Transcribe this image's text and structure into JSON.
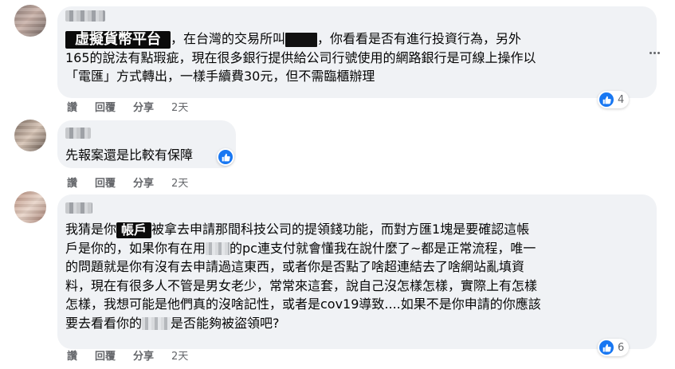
{
  "comments": [
    {
      "label_badge": "虛擬貨幣平台",
      "text_line1_a": "，在台灣的交易所叫",
      "text_line1_b": "，你看看是否有進行投資行為，另外",
      "text_line2": "165的說法有點瑕疵，現在很多銀行提供給公司行號使用的網路銀行是可線上操作以",
      "text_line3": "「電匯」方式轉出，一樣手續費30元，但不需臨櫃辦理",
      "actions": {
        "like": "讚",
        "reply": "回覆",
        "share": "分享",
        "time": "2天"
      },
      "reaction_count": "4"
    },
    {
      "text_line1": "先報案還是比較有保障",
      "actions": {
        "like": "讚",
        "reply": "回覆",
        "share": "分享",
        "time": "2天"
      }
    },
    {
      "line1_a": "我猜是你",
      "line1_badge": "帳戶",
      "line1_b": "被拿去申請那間科技公司的提領錢功能，而對方匯1塊是要確認這帳",
      "line2_a": "戶是你的，如果你有在用",
      "line2_b": "的pc連支付就會懂我在說什麼了~都是正常流程，唯一",
      "line3": "的問題就是你有沒有去申請過這東西，或者你是否點了啥超連結去了啥網站亂填資",
      "line4": "料，現在有很多人不管是男女老少，常常來這套，說自己沒怎樣怎樣，實際上有怎樣",
      "line5": "怎樣，我想可能是他們真的沒啥記性，或者是cov19導致....如果不是你申請的你應該",
      "line6_a": "要去看看你的",
      "line6_b": "是否能夠被盜領吧?",
      "actions": {
        "like": "讚",
        "reply": "回覆",
        "share": "分享",
        "time": "2天"
      },
      "reaction_count": "6"
    }
  ],
  "colors": {
    "bubble": "#f0f2f5",
    "like_blue": "#1877f2",
    "meta_gray": "#65676b"
  }
}
